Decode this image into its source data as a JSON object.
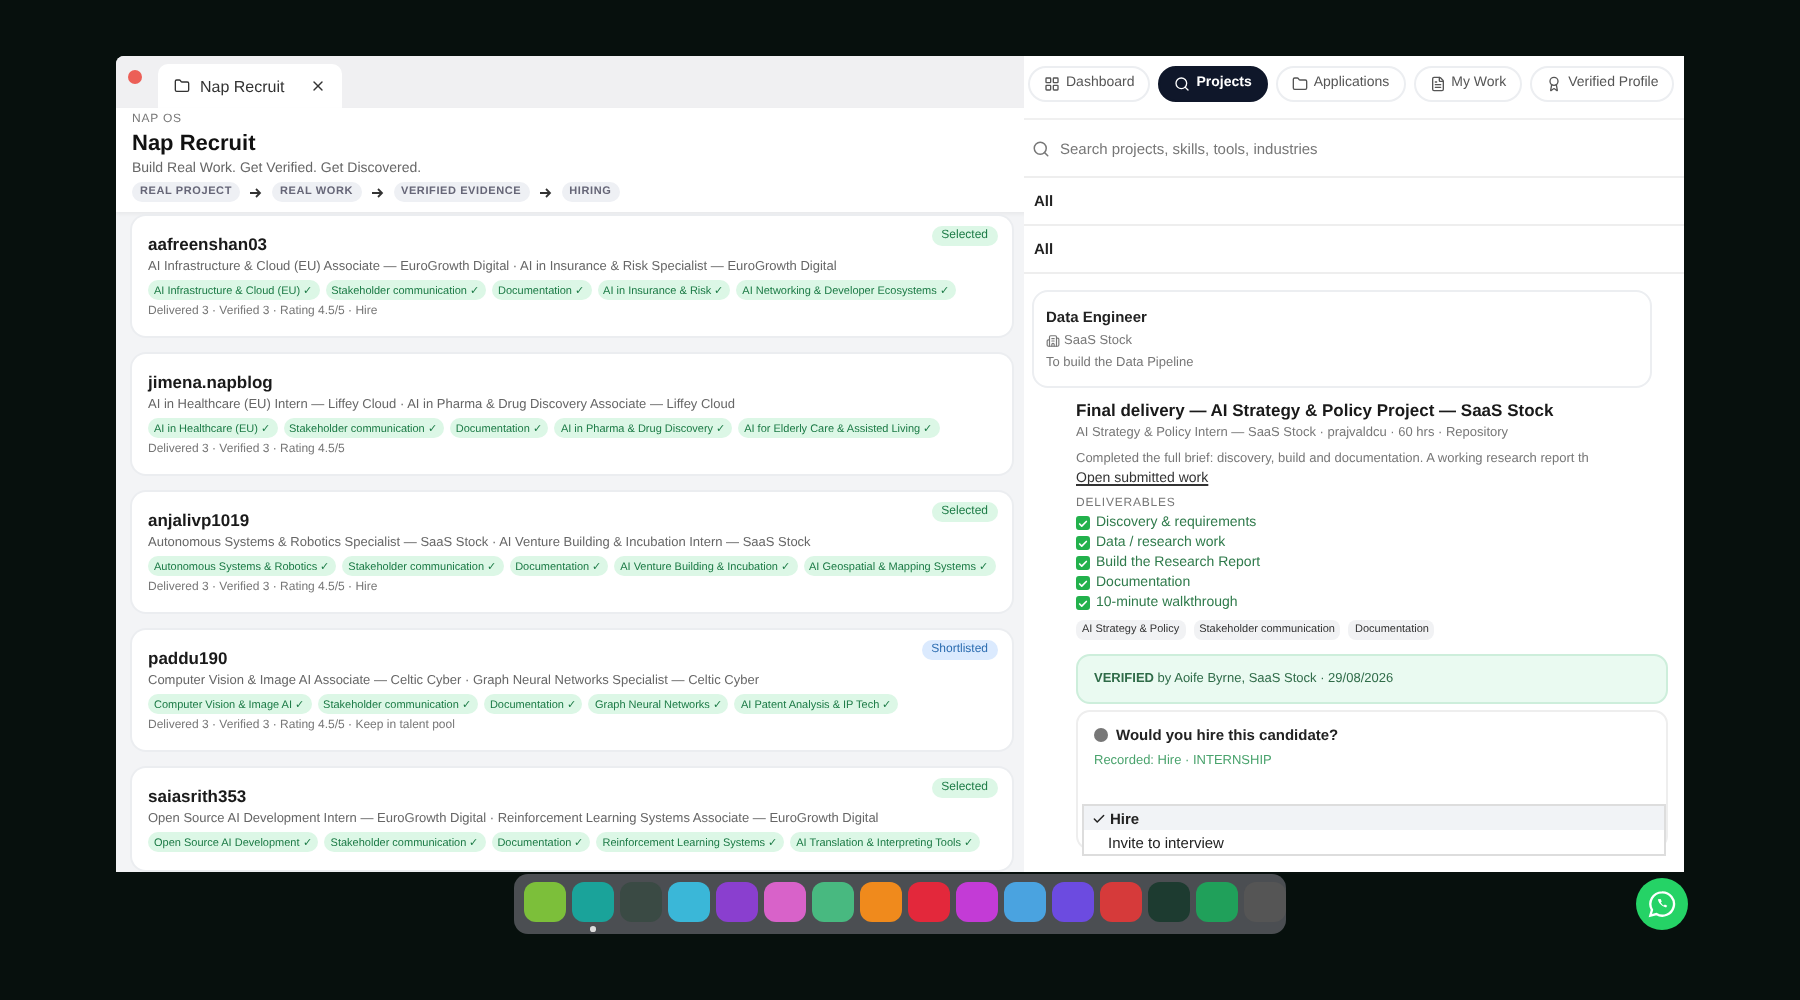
{
  "window": {
    "tab_title": "Nap Recruit"
  },
  "header": {
    "eyebrow": "NAP OS",
    "title": "Nap Recruit",
    "subtitle": "Build Real Work. Get Verified. Get Discovered.",
    "steps": [
      "REAL PROJECT",
      "REAL WORK",
      "VERIFIED EVIDENCE",
      "HIRING"
    ]
  },
  "candidates": [
    {
      "name": "aafreenshan03",
      "roles": "AI Infrastructure & Cloud (EU) Associate — EuroGrowth Digital · AI in Insurance & Risk Specialist — EuroGrowth Digital",
      "skills": [
        "AI Infrastructure & Cloud (EU) ✓",
        "Stakeholder communication ✓",
        "Documentation ✓",
        "AI in Insurance & Risk ✓",
        "AI Networking & Developer Ecosystems ✓"
      ],
      "meta": "Delivered 3 · Verified 3 · Rating 4.5/5 · Hire",
      "status": {
        "kind": "selected",
        "label": "Selected"
      }
    },
    {
      "name": "jimena.napblog",
      "roles": "AI in Healthcare (EU) Intern — Liffey Cloud · AI in Pharma & Drug Discovery Associate — Liffey Cloud",
      "skills": [
        "AI in Healthcare (EU) ✓",
        "Stakeholder communication ✓",
        "Documentation ✓",
        "AI in Pharma & Drug Discovery ✓",
        "AI for Elderly Care & Assisted Living ✓"
      ],
      "meta": "Delivered 3 · Verified 3 · Rating 4.5/5"
    },
    {
      "name": "anjalivp1019",
      "roles": "Autonomous Systems & Robotics Specialist — SaaS Stock · AI Venture Building & Incubation Intern — SaaS Stock",
      "skills": [
        "Autonomous Systems & Robotics ✓",
        "Stakeholder communication ✓",
        "Documentation ✓",
        "AI Venture Building & Incubation ✓",
        "AI Geospatial & Mapping Systems ✓"
      ],
      "meta": "Delivered 3 · Verified 3 · Rating 4.5/5 · Hire",
      "status": {
        "kind": "selected",
        "label": "Selected"
      }
    },
    {
      "name": "paddu190",
      "roles": "Computer Vision & Image AI Associate — Celtic Cyber · Graph Neural Networks Specialist — Celtic Cyber",
      "skills": [
        "Computer Vision & Image AI ✓",
        "Stakeholder communication ✓",
        "Documentation ✓",
        "Graph Neural Networks ✓",
        "AI Patent Analysis & IP Tech ✓"
      ],
      "meta": "Delivered 3 · Verified 3 · Rating 4.5/5 · Keep in talent pool",
      "status": {
        "kind": "shortlisted",
        "label": "Shortlisted"
      }
    },
    {
      "name": "saiasrith353",
      "roles": "Open Source AI Development Intern — EuroGrowth Digital · Reinforcement Learning Systems Associate — EuroGrowth Digital",
      "skills": [
        "Open Source AI Development ✓",
        "Stakeholder communication ✓",
        "Documentation ✓",
        "Reinforcement Learning Systems ✓",
        "AI Translation & Interpreting Tools ✓"
      ],
      "status": {
        "kind": "selected",
        "label": "Selected"
      }
    }
  ],
  "nav": [
    {
      "label": "Dashboard",
      "selected": false
    },
    {
      "label": "Projects",
      "selected": true
    },
    {
      "label": "Applications",
      "selected": false
    },
    {
      "label": "My Work",
      "selected": false
    },
    {
      "label": "Verified Profile",
      "selected": false
    }
  ],
  "search": {
    "placeholder": "Search projects, skills, tools, industries"
  },
  "filters": [
    "All",
    "All"
  ],
  "project": {
    "title": "Data Engineer",
    "company": "SaaS Stock",
    "description": "To build the Data Pipeline"
  },
  "delivery": {
    "title": "Final delivery — AI Strategy & Policy Project — SaaS Stock",
    "meta": "AI Strategy & Policy Intern — SaaS Stock · prajvaldcu · 60 hrs · Repository",
    "summary": "Completed the full brief: discovery, build and documentation. A working research report th",
    "link": "Open submitted work",
    "deliverables_heading": "DELIVERABLES",
    "deliverables": [
      {
        "label": "Discovery & requirements",
        "checked": true
      },
      {
        "label": "Data / research work",
        "checked": true
      },
      {
        "label": "Build the Research Report",
        "checked": true
      },
      {
        "label": "Documentation",
        "checked": true
      },
      {
        "label": "10-minute walkthrough",
        "checked": true
      }
    ],
    "tags": [
      "AI Strategy & Policy",
      "Stakeholder communication",
      "Documentation"
    ],
    "verification": "**VERIFIED** by Aoife Byrne, SaaS Stock · 29/08/2026",
    "hire": {
      "question": "Would you hire this candidate?",
      "recorded": "Recorded: Hire · INTERNSHIP",
      "options": [
        {
          "label": "Hire",
          "selected": true
        },
        {
          "label": "Invite to interview",
          "selected": false
        }
      ]
    }
  },
  "dock": [
    {
      "running": false
    },
    {
      "running": true
    },
    {
      "running": false
    },
    {
      "running": false
    },
    {
      "running": false
    },
    {
      "running": false
    },
    {
      "running": false
    },
    {
      "running": false
    },
    {
      "running": false
    },
    {
      "running": false
    },
    {
      "running": false
    },
    {
      "running": false
    },
    {
      "running": false
    },
    {
      "running": false
    },
    {
      "running": false
    },
    {
      "running": false
    }
  ]
}
